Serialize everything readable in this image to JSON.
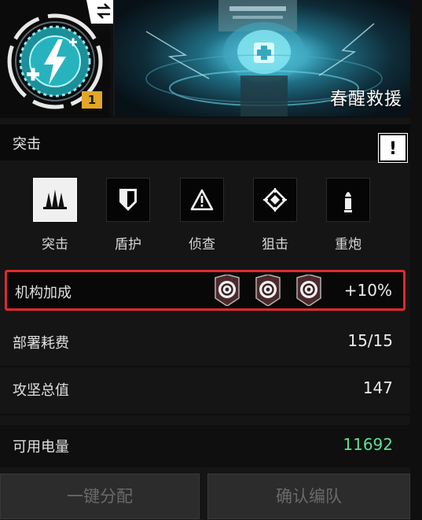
{
  "header": {
    "level": "1",
    "banner_title": "春醒救援"
  },
  "panel": {
    "title": "突击",
    "info_label": "!",
    "classes": [
      {
        "label": "突击",
        "icon": "assault-icon",
        "active": true
      },
      {
        "label": "盾护",
        "icon": "shield-icon",
        "active": false
      },
      {
        "label": "侦查",
        "icon": "warning-triangle-icon",
        "active": false
      },
      {
        "label": "狙击",
        "icon": "crosshair-icon",
        "active": false
      },
      {
        "label": "重炮",
        "icon": "bullet-icon",
        "active": false
      }
    ],
    "bonus": {
      "label": "机构加成",
      "value": "+10%",
      "icon_count": 3,
      "icon": "organization-emblem-icon"
    },
    "deploy_cost": {
      "label": "部署耗费",
      "value": "15/15"
    },
    "assault_total": {
      "label": "攻坚总值",
      "value": "147"
    },
    "power": {
      "label": "可用电量",
      "value": "11692",
      "color": "#5ee08f"
    }
  },
  "buttons": {
    "auto_assign": "一键分配",
    "confirm": "确认编队"
  }
}
